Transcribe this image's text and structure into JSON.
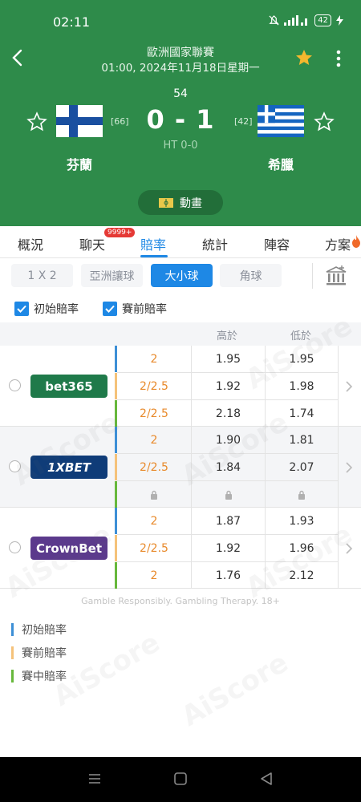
{
  "status_bar": {
    "time": "02:11",
    "battery": "42"
  },
  "match": {
    "league": "歐洲國家聯賽",
    "datetime": "01:00, 2024年11月18日星期一",
    "minute": "54",
    "home": {
      "name": "芬蘭",
      "rank": "[66]"
    },
    "away": {
      "name": "希臘",
      "rank": "[42]"
    },
    "score": "0 - 1",
    "halftime": "HT 0-0",
    "animation_label": "動畫"
  },
  "tabs": [
    {
      "label": "概況"
    },
    {
      "label": "聊天",
      "badge": "9999+"
    },
    {
      "label": "賠率",
      "active": true
    },
    {
      "label": "統計"
    },
    {
      "label": "陣容"
    },
    {
      "label": "方案"
    }
  ],
  "markets": [
    {
      "label": "1 X 2"
    },
    {
      "label": "亞洲讓球"
    },
    {
      "label": "大小球",
      "active": true
    },
    {
      "label": "角球"
    }
  ],
  "filters": {
    "initial": "初始賠率",
    "prematch": "賽前賠率"
  },
  "table": {
    "headers": {
      "over": "高於",
      "under": "低於"
    },
    "bookmakers": [
      {
        "name": "bet365",
        "rows": [
          {
            "type": "initial",
            "line": "2",
            "over": "1.95",
            "under": "1.95"
          },
          {
            "type": "prematch",
            "line": "2/2.5",
            "over": "1.92",
            "under": "1.98"
          },
          {
            "type": "live",
            "line": "2/2.5",
            "over": "2.18",
            "under": "1.74"
          }
        ]
      },
      {
        "name": "1XBET",
        "rows": [
          {
            "type": "initial",
            "line": "2",
            "over": "1.90",
            "under": "1.81"
          },
          {
            "type": "prematch",
            "line": "2/2.5",
            "over": "1.84",
            "under": "2.07"
          },
          {
            "type": "live",
            "locked": true
          }
        ]
      },
      {
        "name": "CrownBet",
        "rows": [
          {
            "type": "initial",
            "line": "2",
            "over": "1.87",
            "under": "1.93"
          },
          {
            "type": "prematch",
            "line": "2/2.5",
            "over": "1.92",
            "under": "1.96"
          },
          {
            "type": "live",
            "line": "2",
            "over": "1.76",
            "under": "2.12"
          }
        ]
      }
    ]
  },
  "disclaimer": "Gamble Responsibly. Gambling Therapy. 18+",
  "legend": {
    "initial": "初始賠率",
    "prematch": "賽前賠率",
    "live": "賽中賠率"
  },
  "watermark": "AiScore",
  "colors": {
    "header_green": "#2e8b4a",
    "accent_blue": "#1e88e5",
    "initial_bar": "#3d8fd6",
    "prematch_bar": "#f5c27a",
    "live_bar": "#67b83c",
    "line_orange": "#e88a2c",
    "bet365_green": "#1f7a4a",
    "onexbet_blue": "#0f3c78",
    "crownbet_purple": "#5b3a8c"
  },
  "icons": {
    "back": "chevron-left-icon",
    "favorite": "star-filled-icon",
    "more": "more-vertical-icon",
    "team_follow": "star-outline-icon",
    "bank": "bank-icon",
    "lock": "lock-icon",
    "expand": "chevron-right-icon"
  }
}
